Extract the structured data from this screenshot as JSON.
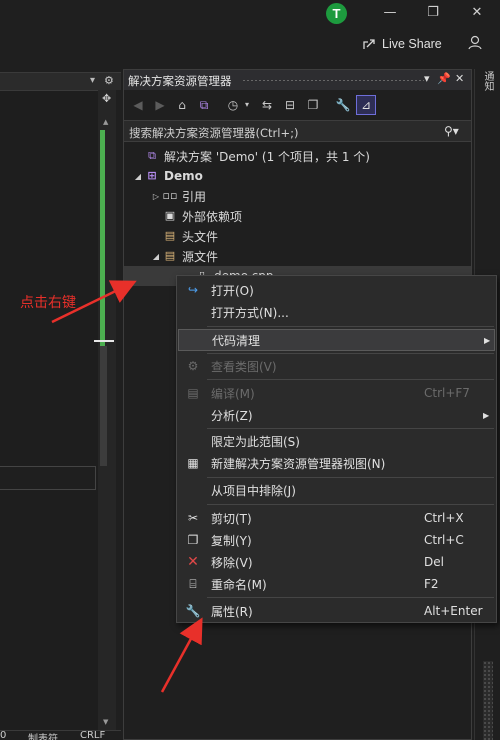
{
  "titlebar": {
    "avatar_letter": "T",
    "minimize": "—",
    "maximize": "❐",
    "close": "✕"
  },
  "toolbar": {
    "live_share_label": "Live Share",
    "feedback_icon": "feedback-icon"
  },
  "left_pane": {
    "tab_menu": "▾",
    "status_items": [
      "0",
      "制表符",
      "CRLF"
    ]
  },
  "solution_explorer": {
    "title": "解决方案资源管理器",
    "search_placeholder": "搜索解决方案资源管理器(Ctrl+;)",
    "tree": {
      "solution": "解决方案 'Demo' (1 个项目，共 1 个)",
      "project": "Demo",
      "references": "引用",
      "external_deps": "外部依赖项",
      "header_files": "头文件",
      "source_files": "源文件",
      "source_file": "demo.cpp"
    },
    "toolbar_icons": [
      "back-icon",
      "forward-icon",
      "home-icon",
      "vs-switch-icon",
      "history-icon",
      "sync-icon",
      "collapse-icon",
      "show-all-files-icon",
      "properties-icon",
      "preview-icon"
    ]
  },
  "context_menu": {
    "items": [
      {
        "label": "打开(O)",
        "shortcut": "",
        "enabled": true
      },
      {
        "label": "打开方式(N)...",
        "shortcut": "",
        "enabled": true
      },
      {
        "label": "代码清理",
        "shortcut": "",
        "enabled": true,
        "submenu": true,
        "highlighted": true
      },
      {
        "label": "查看类图(V)",
        "shortcut": "",
        "enabled": false
      },
      {
        "label": "编译(M)",
        "shortcut": "Ctrl+F7",
        "enabled": false
      },
      {
        "label": "分析(Z)",
        "shortcut": "",
        "enabled": true,
        "submenu": true
      },
      {
        "label": "限定为此范围(S)",
        "shortcut": "",
        "enabled": true
      },
      {
        "label": "新建解决方案资源管理器视图(N)",
        "shortcut": "",
        "enabled": true
      },
      {
        "label": "从项目中排除(J)",
        "shortcut": "",
        "enabled": true
      },
      {
        "label": "剪切(T)",
        "shortcut": "Ctrl+X",
        "enabled": true
      },
      {
        "label": "复制(Y)",
        "shortcut": "Ctrl+C",
        "enabled": true
      },
      {
        "label": "移除(V)",
        "shortcut": "Del",
        "enabled": true
      },
      {
        "label": "重命名(M)",
        "shortcut": "F2",
        "enabled": true
      },
      {
        "label": "属性(R)",
        "shortcut": "Alt+Enter",
        "enabled": true
      }
    ]
  },
  "annotation": {
    "text": "点击右键",
    "color": "#e8302a"
  },
  "side_tab": {
    "label": "通知"
  },
  "colors": {
    "accent_green": "#4caf50",
    "avatar": "#1d9a3e",
    "selected_tool": "#6e6eda"
  }
}
